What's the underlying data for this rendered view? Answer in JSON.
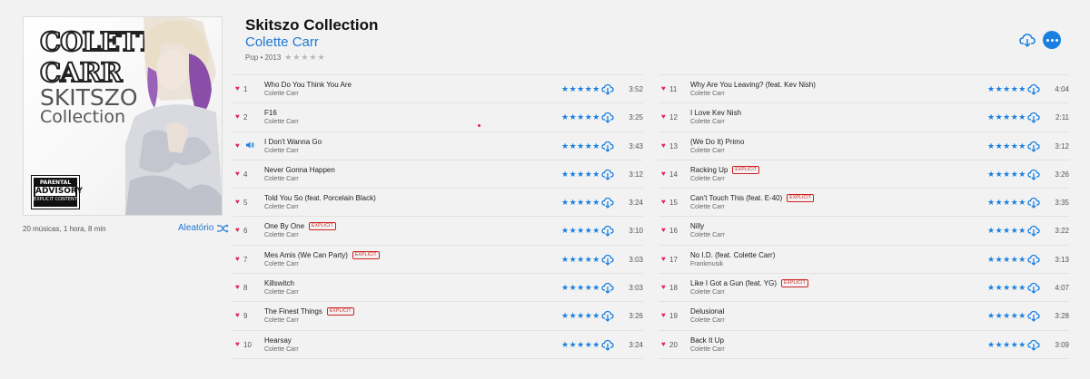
{
  "album": {
    "title": "Skitszo Collection",
    "artist": "Colette Carr",
    "genre_year": "Pop • 2013",
    "rating_stars": "★★★★★",
    "summary": "20 músicas, 1 hora, 8 min",
    "shuffle_label": "Aleatório",
    "art": {
      "logo_text": "COLETTE CARR",
      "title_line1": "SKITSZO",
      "title_line2": "Collection",
      "advisory_line1": "PARENTAL",
      "advisory_line2": "ADVISORY",
      "advisory_line3": "EXPLICIT CONTENT"
    }
  },
  "icons": {
    "download": "cloud-download-icon",
    "more": "more-ellipsis-icon",
    "shuffle": "shuffle-icon",
    "heart": "heart-icon",
    "playing": "speaker-icon"
  },
  "colors": {
    "accent": "#1a7fe0",
    "heart": "#e0245e",
    "explicit": "#d02020"
  },
  "explicit_label": "EXPLICIT",
  "tracks_left": [
    {
      "num": "1",
      "title": "Who Do You Think You Are",
      "artist": "Colette Carr",
      "duration": "3:52",
      "explicit": false,
      "playing": false,
      "stars": "★★★★★"
    },
    {
      "num": "2",
      "title": "F16",
      "artist": "Colette Carr",
      "duration": "3:25",
      "explicit": false,
      "playing": false,
      "stars": "★★★★★"
    },
    {
      "num": "3",
      "title": "I Don't Wanna Go",
      "artist": "Colette Carr",
      "duration": "3:43",
      "explicit": false,
      "playing": true,
      "stars": "★★★★★"
    },
    {
      "num": "4",
      "title": "Never Gonna Happen",
      "artist": "Colette Carr",
      "duration": "3:12",
      "explicit": false,
      "playing": false,
      "stars": "★★★★★"
    },
    {
      "num": "5",
      "title": "Told You So (feat. Porcelain Black)",
      "artist": "Colette Carr",
      "duration": "3:24",
      "explicit": false,
      "playing": false,
      "stars": "★★★★★"
    },
    {
      "num": "6",
      "title": "One By One",
      "artist": "Colette Carr",
      "duration": "3:10",
      "explicit": true,
      "playing": false,
      "stars": "★★★★★"
    },
    {
      "num": "7",
      "title": "Mes Amis (We Can Party)",
      "artist": "Colette Carr",
      "duration": "3:03",
      "explicit": true,
      "playing": false,
      "stars": "★★★★★"
    },
    {
      "num": "8",
      "title": "Killswitch",
      "artist": "Colette Carr",
      "duration": "3:03",
      "explicit": false,
      "playing": false,
      "stars": "★★★★★"
    },
    {
      "num": "9",
      "title": "The Finest Things",
      "artist": "Colette Carr",
      "duration": "3:26",
      "explicit": true,
      "playing": false,
      "stars": "★★★★★"
    },
    {
      "num": "10",
      "title": "Hearsay",
      "artist": "Colette Carr",
      "duration": "3:24",
      "explicit": false,
      "playing": false,
      "stars": "★★★★★"
    }
  ],
  "tracks_right": [
    {
      "num": "11",
      "title": "Why Are You Leaving? (feat. Kev Nish)",
      "artist": "Colette Carr",
      "duration": "4:04",
      "explicit": false,
      "playing": false,
      "stars": "★★★★★"
    },
    {
      "num": "12",
      "title": "I Love Kev Nish",
      "artist": "Colette Carr",
      "duration": "2:11",
      "explicit": false,
      "playing": false,
      "stars": "★★★★★"
    },
    {
      "num": "13",
      "title": "(We Do It) Primo",
      "artist": "Colette Carr",
      "duration": "3:12",
      "explicit": false,
      "playing": false,
      "stars": "★★★★★"
    },
    {
      "num": "14",
      "title": "Racking Up",
      "artist": "Colette Carr",
      "duration": "3:26",
      "explicit": true,
      "playing": false,
      "stars": "★★★★★"
    },
    {
      "num": "15",
      "title": "Can't Touch This (feat. E-40)",
      "artist": "Colette Carr",
      "duration": "3:35",
      "explicit": true,
      "playing": false,
      "stars": "★★★★★"
    },
    {
      "num": "16",
      "title": "Nilly",
      "artist": "Colette Carr",
      "duration": "3:22",
      "explicit": false,
      "playing": false,
      "stars": "★★★★★"
    },
    {
      "num": "17",
      "title": "No I.D. (feat. Colette Carr)",
      "artist": "Frankmusik",
      "duration": "3:13",
      "explicit": false,
      "playing": false,
      "stars": "★★★★★"
    },
    {
      "num": "18",
      "title": "Like I Got a Gun (feat. YG)",
      "artist": "Colette Carr",
      "duration": "4:07",
      "explicit": true,
      "playing": false,
      "stars": "★★★★★"
    },
    {
      "num": "19",
      "title": "Delusional",
      "artist": "Colette Carr",
      "duration": "3:28",
      "explicit": false,
      "playing": false,
      "stars": "★★★★★"
    },
    {
      "num": "20",
      "title": "Back It Up",
      "artist": "Colette Carr",
      "duration": "3:09",
      "explicit": false,
      "playing": false,
      "stars": "★★★★★"
    }
  ]
}
